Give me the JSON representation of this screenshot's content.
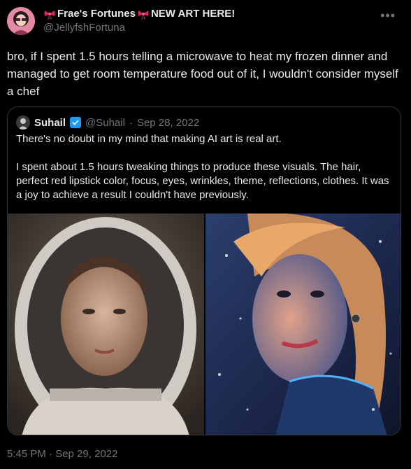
{
  "author": {
    "display_name_prefix_icon": "bow-icon",
    "display_name_text": "Frae's Fortunes",
    "display_name_suffix_icon": "bow-icon",
    "display_name_tail": "NEW ART HERE!",
    "handle": "@JellyfshFortuna",
    "avatar_icon": "avatar"
  },
  "more_icon": "more-options-icon",
  "tweet_text": "bro, if I spent 1.5 hours telling a microwave to heat my frozen dinner and managed to get room temperature food out of it, I wouldn't consider myself a chef",
  "quote": {
    "name": "Suhail",
    "verified_icon": "verified-badge-icon",
    "handle": "@Suhail",
    "separator": "·",
    "date": "Sep 28, 2022",
    "paragraph_1": "There's no doubt in my mind that making AI art is real art.",
    "paragraph_2": "I spent about 1.5 hours tweaking things to produce these visuals. The hair, perfect red lipstick color, focus, eyes, wrinkles, theme, reflections, clothes. It was a joy to achieve a result I couldn't have previously.",
    "media": [
      {
        "icon": "astronaut-portrait-image"
      },
      {
        "icon": "space-woman-portrait-image"
      }
    ]
  },
  "timestamp": "5:45 PM · Sep 29, 2022",
  "colors": {
    "background": "#000000",
    "text": "#e7e9ea",
    "muted": "#71767b",
    "border": "#2f3336",
    "verified": "#1d9bf0",
    "bow": "#e0245e"
  }
}
